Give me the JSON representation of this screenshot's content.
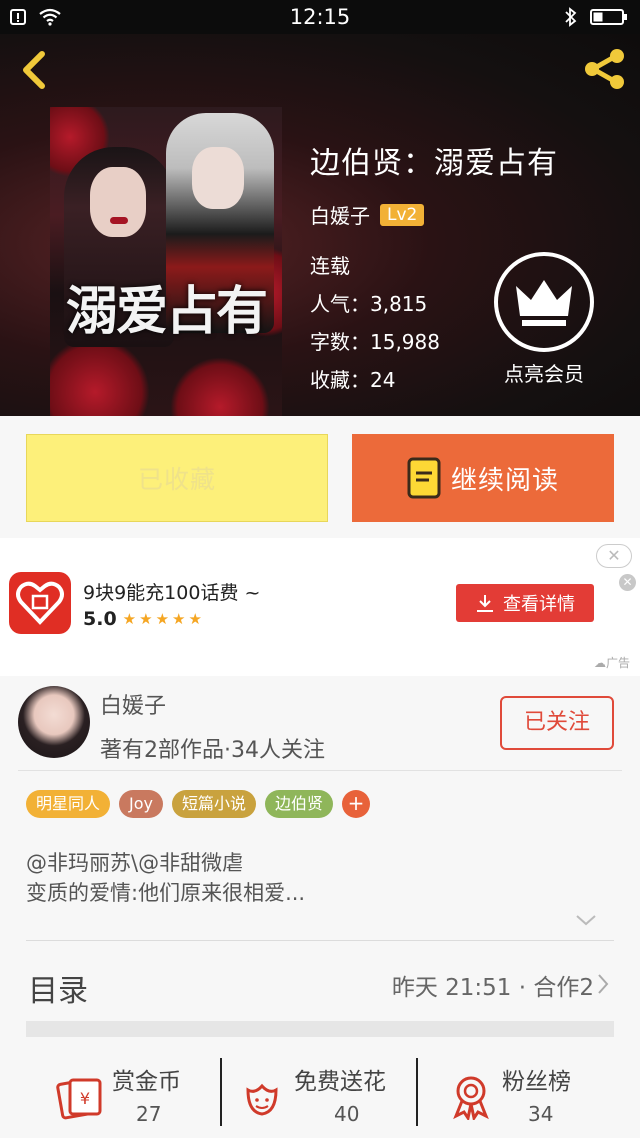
{
  "status_bar": {
    "time": "12:15"
  },
  "book": {
    "title": "边伯贤：溺爱占有",
    "author": "白媛子",
    "author_level": "Lv2",
    "status": "连载",
    "popularity_label": "人气：",
    "popularity": "3,815",
    "word_count_label": "字数：",
    "word_count": "15,988",
    "favorites_label": "收藏：",
    "favorites": "24",
    "cover_title_art": "溺爱占有"
  },
  "vip": {
    "label": "点亮会员"
  },
  "actions": {
    "favorited_label": "已收藏",
    "continue_label": "继续阅读"
  },
  "ad": {
    "title": "9块9能充100话费 ~",
    "rating": "5.0",
    "stars": "★★★★★",
    "button_label": "查看详情",
    "tag": "广告",
    "close_symbol": "✕"
  },
  "author_card": {
    "name": "白媛子",
    "summary": "著有2部作品·34人关注",
    "follow_label": "已关注"
  },
  "tags": [
    {
      "label": "明星同人",
      "color": "#f2b136"
    },
    {
      "label": "Joy",
      "color": "#c9795f"
    },
    {
      "label": "短篇小说",
      "color": "#c9a23e"
    },
    {
      "label": "边伯贤",
      "color": "#8fb65a"
    },
    {
      "label": "+",
      "color": "#e8623a"
    }
  ],
  "description": {
    "line1": "@非玛丽苏\\@非甜微虐",
    "line2": "变质的爱情:他们原来很相爱..."
  },
  "toc": {
    "label": "目录",
    "meta": "昨天 21:51 · 合作2"
  },
  "bottom_stats": [
    {
      "label": "赏金币",
      "count": "27",
      "icon": "coin-envelope-icon"
    },
    {
      "label": "免费送花",
      "count": "40",
      "icon": "flower-icon"
    },
    {
      "label": "粉丝榜",
      "count": "34",
      "icon": "ribbon-badge-icon"
    }
  ],
  "colors": {
    "accent_orange": "#ec6a3a",
    "accent_red": "#e04a3a",
    "fav_yellow": "#fdf07a",
    "level_badge": "#f2b136",
    "back_icon": "#f0c93a"
  }
}
